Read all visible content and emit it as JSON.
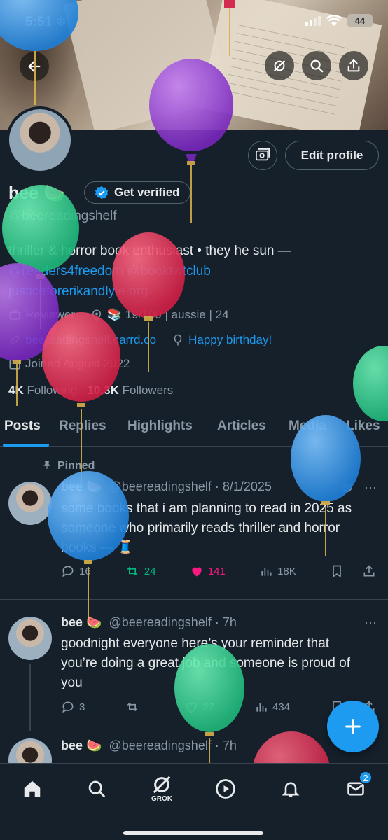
{
  "status": {
    "time": "5:51",
    "battery": "44"
  },
  "profile": {
    "name": "bee",
    "verify_label": "Get verified",
    "edit_label": "Edit profile",
    "handle": "@beereadingshelf",
    "bio_text": "thriller & horror book enthusiast • they he sun —",
    "bio_links": "@readers4freedom @booktwtclub",
    "bio_link2": "justiceforerikandlyle.org",
    "category": "Reviewer",
    "location": "📚 19/100 | aussie | 24",
    "website": "beereadingshelf.carrd.co",
    "birthday": "Happy birthday!",
    "joined": "Joined August 2022",
    "following_count": "4K",
    "following_label": "Following",
    "followers_count": "10.3K",
    "followers_label": "Followers"
  },
  "tabs": [
    "Posts",
    "Replies",
    "Highlights",
    "Articles",
    "Media",
    "Likes"
  ],
  "posts": [
    {
      "pinned_label": "Pinned",
      "name": "bee 🍉",
      "handle": "@beereadingshelf",
      "time": "8/1/2025",
      "text": "some books that i am planning to read in 2025 as someone who primarily reads thriller and horror books — 🧵",
      "replies": "16",
      "reposts": "24",
      "likes": "141",
      "views": "18K"
    },
    {
      "name": "bee 🍉",
      "handle": "@beereadingshelf",
      "time": "7h",
      "text": "goodnight everyone here’s your reminder that you’re doing a great job and someone is proud of you",
      "replies": "3",
      "reposts": "",
      "likes": "27",
      "views": "434"
    },
    {
      "name": "bee 🍉",
      "handle": "@beereadingshelf",
      "time": "7h"
    }
  ],
  "nav": {
    "grok_label": "GROK",
    "messages_badge": "2"
  },
  "colors": {
    "accent": "#1d9bf0",
    "background": "#15202b",
    "like": "#f91880",
    "repost": "#00ba7c"
  }
}
